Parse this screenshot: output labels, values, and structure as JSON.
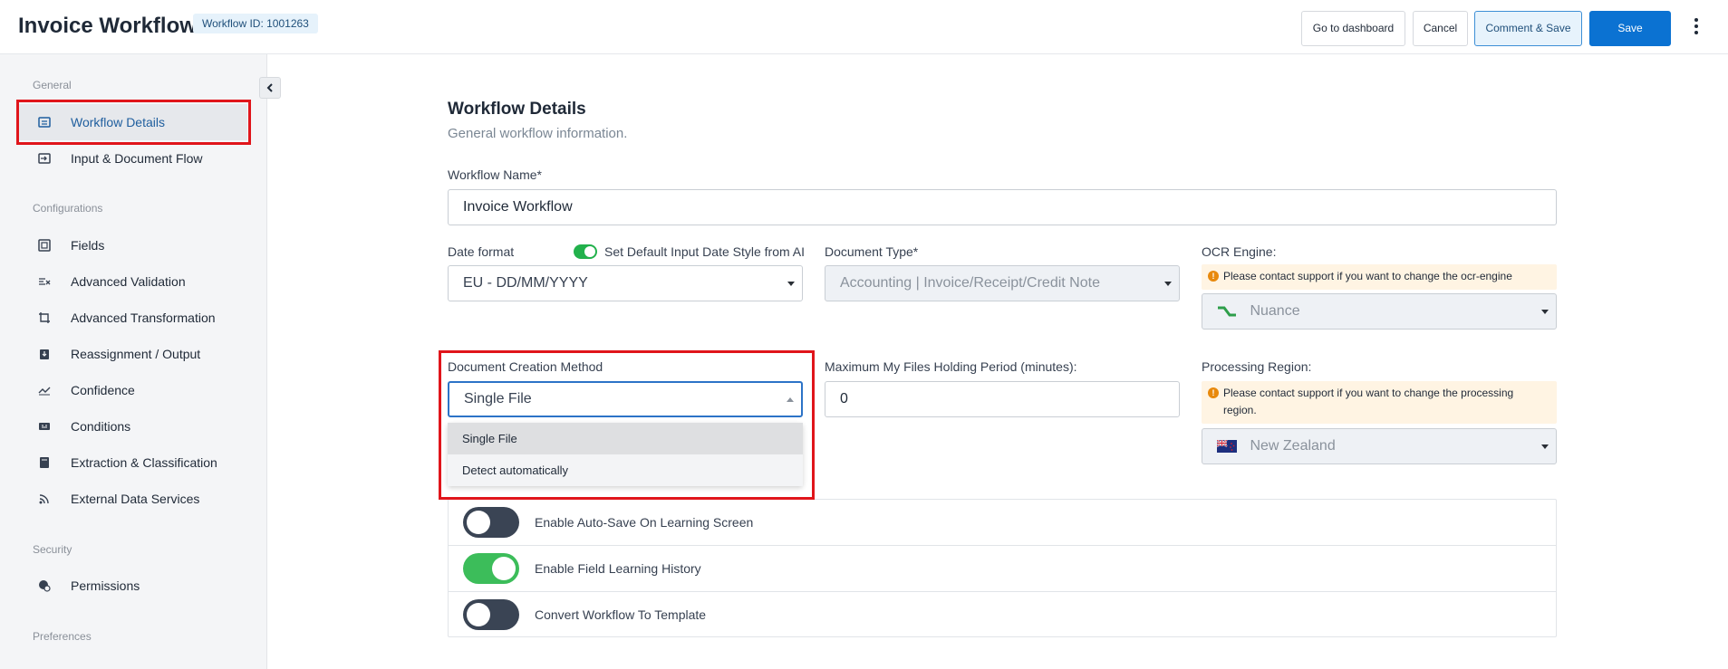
{
  "header": {
    "title": "Invoice Workflow",
    "workflow_id": "Workflow ID: 1001263",
    "buttons": {
      "dashboard": "Go to dashboard",
      "cancel": "Cancel",
      "comment_save": "Comment & Save",
      "save": "Save"
    }
  },
  "sidebar": {
    "sections": {
      "general": "General",
      "configurations": "Configurations",
      "security": "Security",
      "preferences": "Preferences"
    },
    "items": [
      {
        "label": "Workflow Details",
        "icon": "details-icon",
        "active": true
      },
      {
        "label": "Input & Document Flow",
        "icon": "input-icon"
      },
      {
        "label": "Fields",
        "icon": "fields-icon"
      },
      {
        "label": "Advanced Validation",
        "icon": "validation-icon"
      },
      {
        "label": "Advanced Transformation",
        "icon": "transform-icon"
      },
      {
        "label": "Reassignment / Output",
        "icon": "output-icon"
      },
      {
        "label": "Confidence",
        "icon": "confidence-icon"
      },
      {
        "label": "Conditions",
        "icon": "conditions-icon"
      },
      {
        "label": "Extraction & Classification",
        "icon": "extraction-icon"
      },
      {
        "label": "External Data Services",
        "icon": "rss-icon"
      },
      {
        "label": "Permissions",
        "icon": "permissions-icon"
      }
    ]
  },
  "main": {
    "title": "Workflow Details",
    "subtitle": "General workflow information.",
    "workflow_name": {
      "label": "Workflow Name*",
      "value": "Invoice Workflow"
    },
    "date_format": {
      "label": "Date format",
      "toggle_label": "Set Default Input Date Style from AI",
      "toggle_on": true,
      "value": "EU - DD/MM/YYYY"
    },
    "document_type": {
      "label": "Document Type*",
      "value": "Accounting | Invoice/Receipt/Credit Note"
    },
    "ocr_engine": {
      "label": "OCR Engine:",
      "warning": "Please contact support if you want to change the ocr-engine",
      "value": "Nuance"
    },
    "document_creation_method": {
      "label": "Document Creation Method",
      "value": "Single File",
      "options": [
        "Single File",
        "Detect automatically"
      ]
    },
    "holding_period": {
      "label": "Maximum My Files Holding Period (minutes):",
      "value": "0"
    },
    "processing_region": {
      "label": "Processing Region:",
      "warning": "Please contact support if you want to change the processing region.",
      "value": "New Zealand"
    },
    "toggles": [
      {
        "label": "Enable Auto-Save On Learning Screen",
        "on": false
      },
      {
        "label": "Enable Field Learning History",
        "on": true
      },
      {
        "label": "Convert Workflow To Template",
        "on": false
      }
    ]
  },
  "colors": {
    "primary": "#0b72d2",
    "highlight": "#e0151b",
    "toggle_on": "#3cbd5a",
    "toggle_off": "#3a4454",
    "warning_bg": "#fff4e3"
  }
}
